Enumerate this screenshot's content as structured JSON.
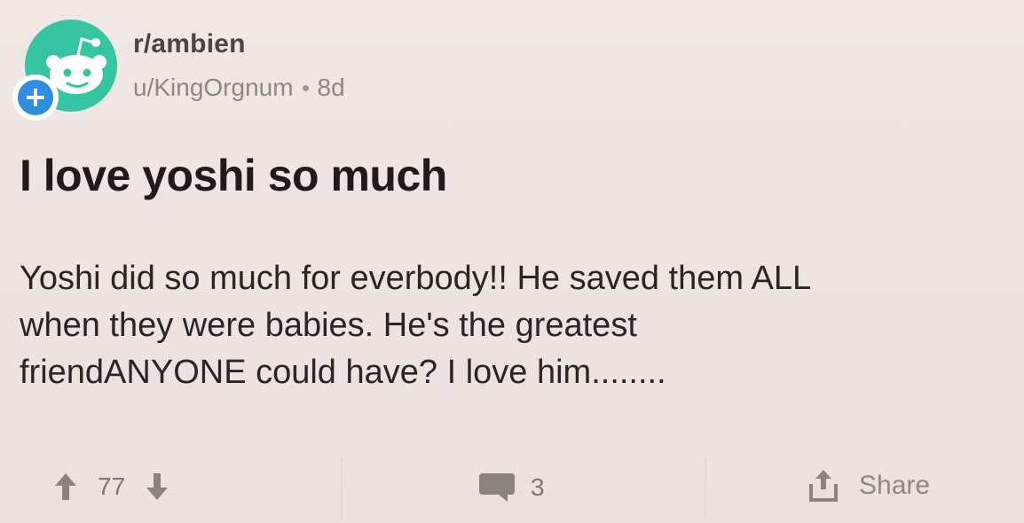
{
  "post": {
    "subreddit": "r/ambien",
    "author": "u/KingOrgnum",
    "age": "8d",
    "title": "I love yoshi so much",
    "body_lines": [
      "Yoshi did so much for everbody!! He saved them ALL",
      "when they were babies. He's the greatest",
      "friendANYONE could have? I love him........"
    ]
  },
  "actions": {
    "vote_count": "77",
    "comment_count": "3",
    "share_label": "Share"
  },
  "icons": {
    "avatar": "reddit-snoo-icon",
    "join": "plus-icon",
    "upvote": "arrow-up-icon",
    "downvote": "arrow-down-icon",
    "comment": "speech-bubble-icon",
    "share": "share-icon"
  },
  "colors": {
    "background": "#efe6e3",
    "avatar_bg": "#36c5a3",
    "join_badge": "#2f8ee0",
    "icon_gray": "#8a8380"
  }
}
